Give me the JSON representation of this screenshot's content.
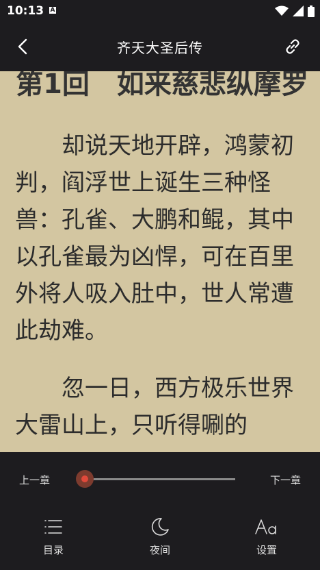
{
  "status": {
    "time": "10:13",
    "notification_icon": "A"
  },
  "appbar": {
    "title": "齐天大圣后传"
  },
  "reader": {
    "chapter_title": "第1回　如来慈悲纵摩罗",
    "paragraphs": [
      "却说天地开辟，鸿蒙初判，阎浮世上诞生三种怪兽：孔雀、大鹏和鲲，其中以孔雀最为凶悍，可在百里外将人吸入肚中，世人常遭此劫难。",
      "忽一日，西方极乐世界大雷山上，只听得唰的"
    ]
  },
  "controls": {
    "prev_chapter": "上一章",
    "next_chapter": "下一章",
    "progress": 0,
    "menu": [
      {
        "label": "目录",
        "icon": "list-icon"
      },
      {
        "label": "夜间",
        "icon": "moon-icon"
      },
      {
        "label": "设置",
        "icon": "font-size-icon"
      }
    ]
  },
  "colors": {
    "bar": "#1d1c1f",
    "paper": "#d3c6a1",
    "accent": "#e0493b"
  }
}
